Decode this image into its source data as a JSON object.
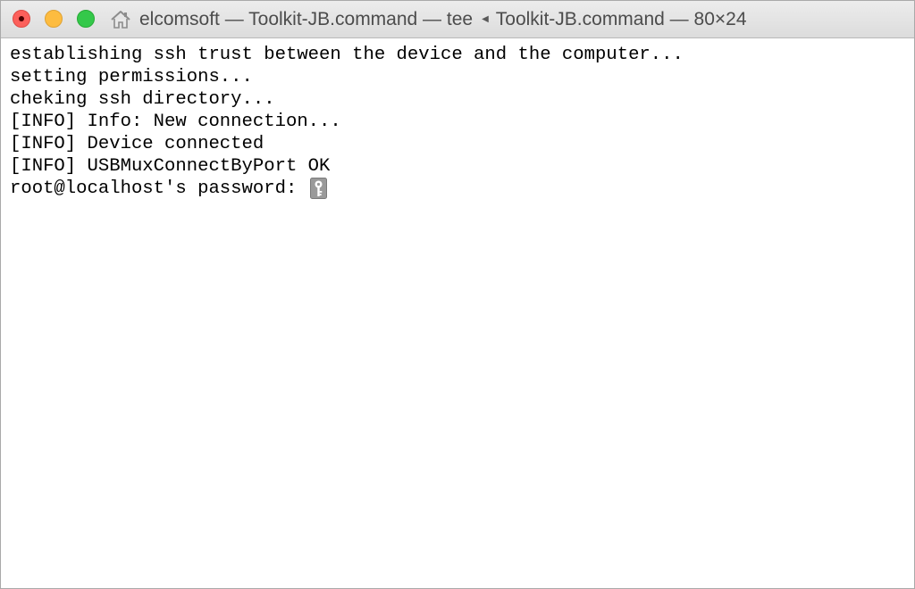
{
  "window": {
    "title_parts": [
      "elcomsoft — Toolkit-JB.command — tee",
      "Toolkit-JB.command — 80×24"
    ],
    "title_separator_icon": "left-triangle-icon",
    "title_icon": "home-icon"
  },
  "terminal": {
    "lines": [
      "establishing ssh trust between the device and the computer...",
      "setting permissions...",
      "cheking ssh directory...",
      "[INFO] Info: New connection...",
      "[INFO] Device connected",
      "[INFO] USBMuxConnectByPort OK",
      "root@localhost's password: "
    ],
    "cursor_icon": "key-icon",
    "background": "#ffffff",
    "foreground": "#000000"
  },
  "colors": {
    "close": "#fc605b",
    "minimize": "#fdbc40",
    "maximize": "#34c84a"
  }
}
